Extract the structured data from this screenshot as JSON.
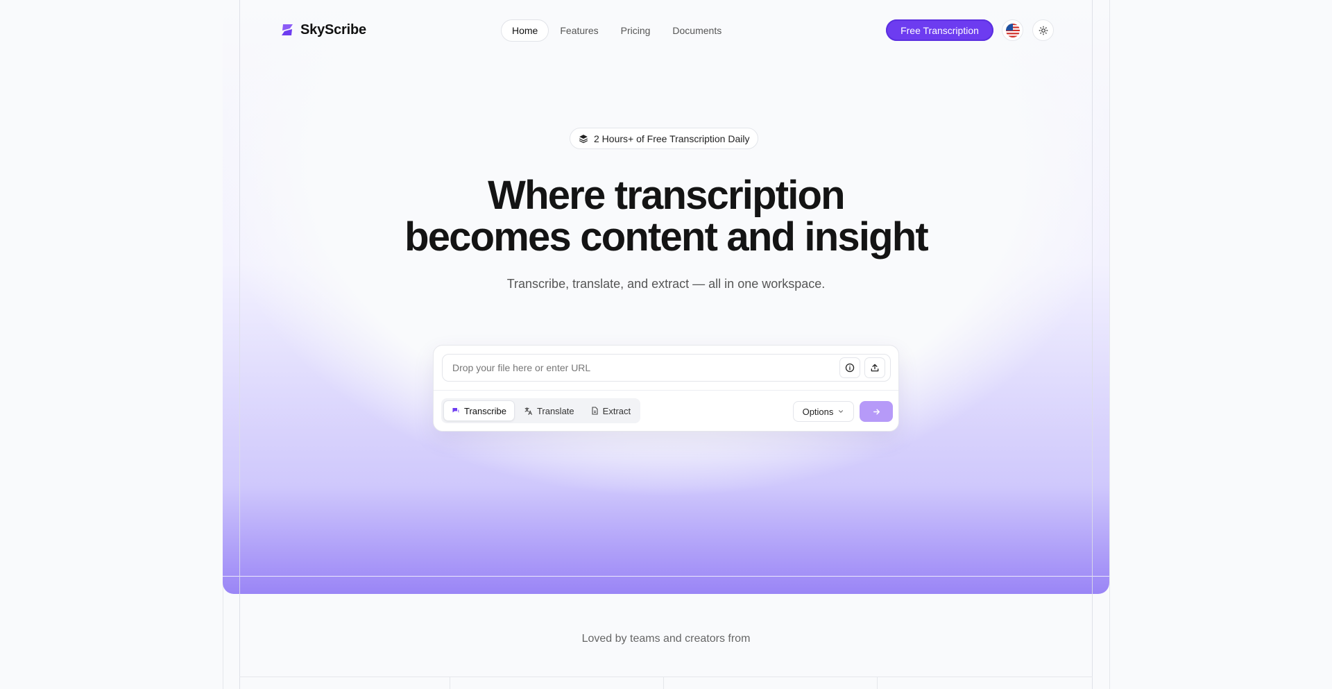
{
  "brand": {
    "name": "SkyScribe",
    "accent": "#6d3cf0"
  },
  "nav": {
    "items": [
      {
        "label": "Home",
        "active": true
      },
      {
        "label": "Features",
        "active": false
      },
      {
        "label": "Pricing",
        "active": false
      },
      {
        "label": "Documents",
        "active": false
      }
    ],
    "cta_label": "Free Transcription",
    "language_icon": "us-flag-icon",
    "theme_icon": "sun-icon"
  },
  "hero": {
    "badge": "2 Hours+ of Free Transcription Daily",
    "headline_line1": "Where transcription",
    "headline_line2": "becomes content and insight",
    "subheadline": "Transcribe, translate, and extract — all in one workspace."
  },
  "input_card": {
    "placeholder": "Drop your file here or enter URL",
    "value": "",
    "modes": [
      {
        "label": "Transcribe",
        "icon": "chat-bubbles-icon",
        "active": true
      },
      {
        "label": "Translate",
        "icon": "translate-icon",
        "active": false
      },
      {
        "label": "Extract",
        "icon": "document-icon",
        "active": false
      }
    ],
    "options_label": "Options",
    "submit_icon": "arrow-right-icon"
  },
  "social_proof": {
    "title": "Loved by teams and creators from"
  }
}
